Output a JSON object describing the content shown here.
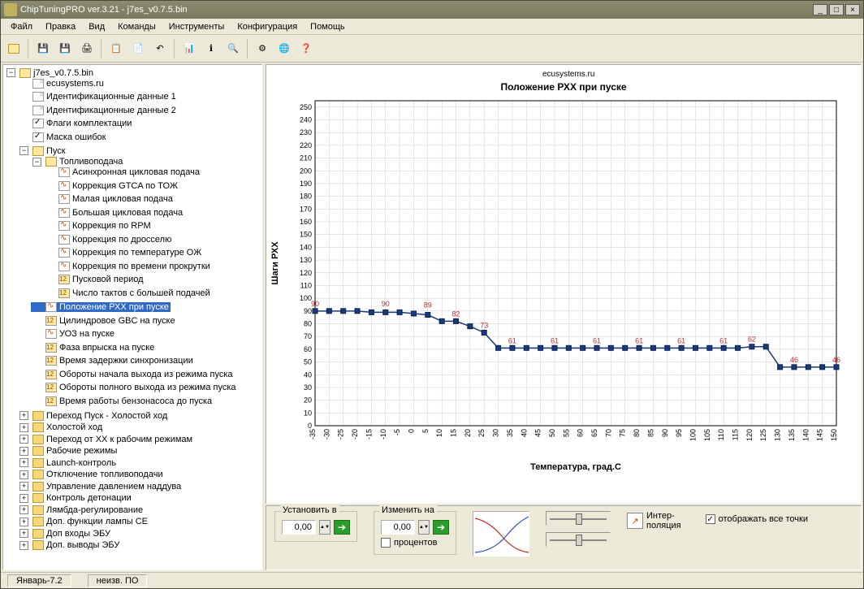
{
  "window": {
    "title": "ChipTuningPRO ver.3.21 - j7es_v0.7.5.bin"
  },
  "menu": [
    "Файл",
    "Правка",
    "Вид",
    "Команды",
    "Инструменты",
    "Конфигурация",
    "Помощь"
  ],
  "tree": {
    "root": "j7es_v0.7.5.bin",
    "items": [
      "ecusystems.ru",
      "Идентификационные данные 1",
      "Идентификационные данные 2",
      "Флаги комплектации",
      "Маска ошибок"
    ],
    "pusk": "Пуск",
    "toplivo": "Топливоподача",
    "toplivo_items": [
      "Асинхронная цикловая подача",
      "Коррекция GTCA по ТОЖ",
      "Малая цикловая подача",
      "Большая цикловая подача",
      "Коррекция по RPM",
      "Коррекция по дросселю",
      "Коррекция по температуре ОЖ",
      "Коррекция по времени прокрутки",
      "Пусковой период",
      "Число тактов с большей подачей"
    ],
    "selected": "Положение РХХ при пуске",
    "after_sel": [
      "Цилиндровое GBC на пуске",
      "УОЗ на пуске",
      "Фаза впрыска на пуске",
      "Время задержки синхронизации",
      "Обороты начала выхода из режима пуска",
      "Обороты полного выхода из режима пуска",
      "Время работы бензонасоса до пуска"
    ],
    "folders": [
      "Переход Пуск - Холостой ход",
      "Холостой ход",
      "Переход от ХХ к рабочим режимам",
      "Рабочие режимы",
      "Launch-контроль",
      "Отключение топливоподачи",
      "Управление давлением наддува",
      "Контроль детонации",
      "Лямбда-регулирование",
      "Доп. функции лампы CE",
      "Доп входы ЭБУ",
      "Доп. выводы ЭБУ"
    ]
  },
  "chart_title_zone": {
    "brand": "ecusystems.ru"
  },
  "chart_data": {
    "type": "line",
    "title": "Положение РХХ при пуске",
    "xlabel": "Температура, град.C",
    "ylabel": "Шаги РХХ",
    "xlim": [
      -35,
      150
    ],
    "ylim": [
      0,
      255
    ],
    "x": [
      -35,
      -30,
      -25,
      -20,
      -15,
      -10,
      -5,
      0,
      5,
      10,
      15,
      20,
      25,
      30,
      35,
      40,
      45,
      50,
      55,
      60,
      65,
      70,
      75,
      80,
      85,
      90,
      95,
      100,
      105,
      110,
      115,
      120,
      125,
      130,
      135,
      140,
      145,
      150
    ],
    "values": [
      90,
      90,
      90,
      90,
      89,
      89,
      89,
      88,
      87,
      82,
      82,
      78,
      73,
      61,
      61,
      61,
      61,
      61,
      61,
      61,
      61,
      61,
      61,
      61,
      61,
      61,
      61,
      61,
      61,
      61,
      61,
      62,
      62,
      46,
      46,
      46,
      46,
      46
    ],
    "labels": {
      "-35": 90,
      "-10": 90,
      "5": 89,
      "15": 82,
      "25": 73,
      "35": 61,
      "50": 61,
      "65": 61,
      "80": 61,
      "95": 61,
      "110": 61,
      "120": 62,
      "135": 46,
      "150": 46
    }
  },
  "controls": {
    "set_label": "Установить в",
    "set_value": "0,00",
    "change_label": "Изменить на",
    "change_value": "0,00",
    "percent_label": "процентов",
    "interp_label": "Интер-\nполяция",
    "showall_label": "отображать все точки",
    "showall_checked": true
  },
  "status": {
    "left": "Январь-7.2",
    "right": "неизв. ПО"
  }
}
